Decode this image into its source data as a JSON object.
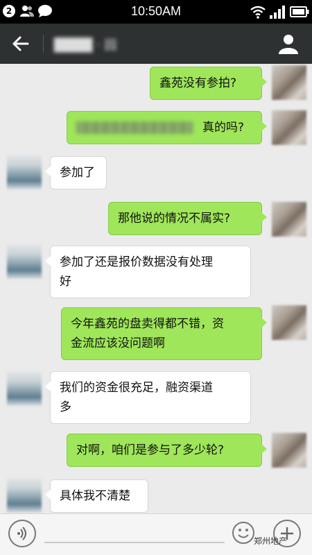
{
  "status_bar": {
    "notification_count": "2",
    "time": "10:50AM"
  },
  "header": {
    "title": "████ ‧ 园"
  },
  "messages": [
    {
      "side": "right",
      "text": "鑫苑没有参拍?"
    },
    {
      "side": "right",
      "text": "真的吗?"
    },
    {
      "side": "left",
      "text": "参加了"
    },
    {
      "side": "right",
      "text": "那他说的情况不属实?"
    },
    {
      "side": "left",
      "lines": [
        "参加了还是报价数据没有处理",
        "好"
      ]
    },
    {
      "side": "right",
      "lines": [
        "今年鑫苑的盘卖得都不错，资",
        "金流应该没问题啊"
      ]
    },
    {
      "side": "left",
      "lines": [
        "我们的资金很充足，融资渠道",
        "多"
      ]
    },
    {
      "side": "right",
      "text": "对啊，咱们是参与了多少轮?"
    },
    {
      "side": "left",
      "text": "具体我不清楚"
    }
  ],
  "watermark": "郑州地产",
  "icons": {
    "back": "back-arrow-icon",
    "profile": "profile-icon",
    "voice": "voice-icon",
    "emoji": "emoji-icon",
    "add": "add-icon"
  },
  "colors": {
    "sent_bubble": "#9fe65a",
    "received_bubble": "#ffffff",
    "title_bar": "#2e3132",
    "chat_background": "#ebebeb"
  }
}
